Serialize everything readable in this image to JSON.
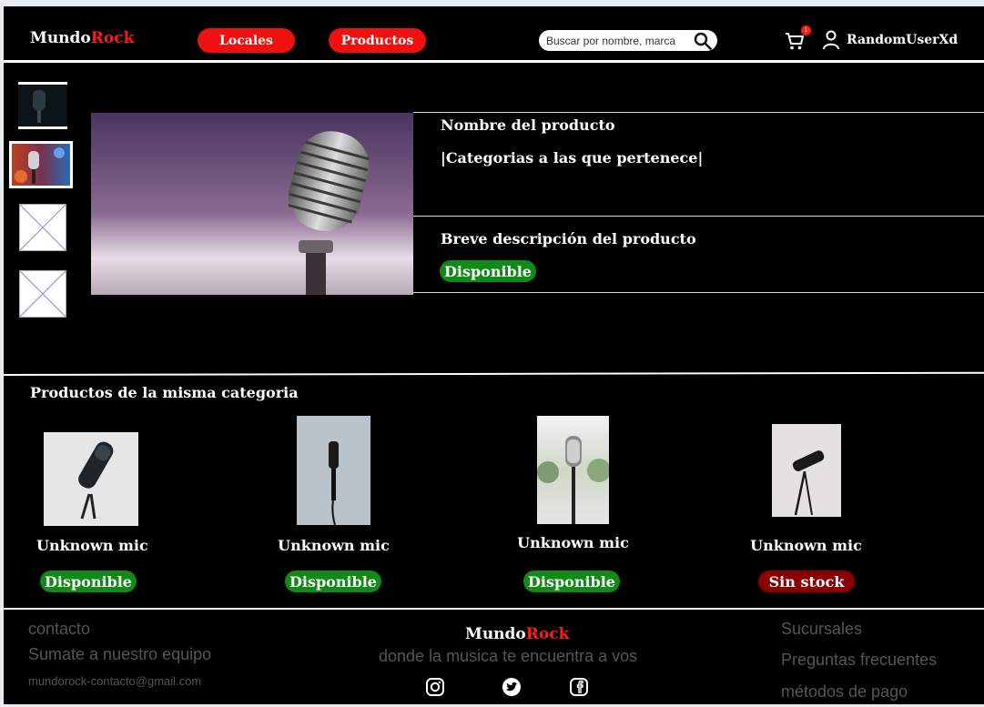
{
  "brand": {
    "name_a": "Mundo",
    "name_b": "Rock"
  },
  "nav": {
    "locales": "Locales",
    "productos": "Productos"
  },
  "search": {
    "placeholder": "Buscar por nombre, marca"
  },
  "cart": {
    "count": "1"
  },
  "user": {
    "name": "RandomUserXd"
  },
  "product": {
    "name": "Nombre del producto",
    "categories": "|Categorias a las que pertenece|",
    "description": "Breve descripción del producto",
    "status": "Disponible"
  },
  "related": {
    "title": "Productos de la misma categoria",
    "items": [
      {
        "name": "Unknown mic",
        "status": "Disponible",
        "available": true
      },
      {
        "name": "Unknown mic",
        "status": "Disponible",
        "available": true
      },
      {
        "name": "Unknown mic",
        "status": "Disponible",
        "available": true
      },
      {
        "name": "Unknown mic",
        "status": "Sin stock",
        "available": false
      }
    ]
  },
  "footer": {
    "contacto": "contacto",
    "sumate": "Sumate a nuestro equipo",
    "email": "mundorock-contacto@gmail.com",
    "tagline": "donde la musica te encuentra a vos",
    "sucursales": "Sucursales",
    "preguntas": "Preguntas frecuentes",
    "metodos": "métodos de pago"
  },
  "colors": {
    "accent": "#f01010",
    "available": "#118a18",
    "out_of_stock": "#8a0000"
  },
  "icons": [
    "search-icon",
    "cart-icon",
    "user-icon",
    "instagram-icon",
    "twitter-icon",
    "facebook-icon",
    "image-placeholder-icon"
  ]
}
